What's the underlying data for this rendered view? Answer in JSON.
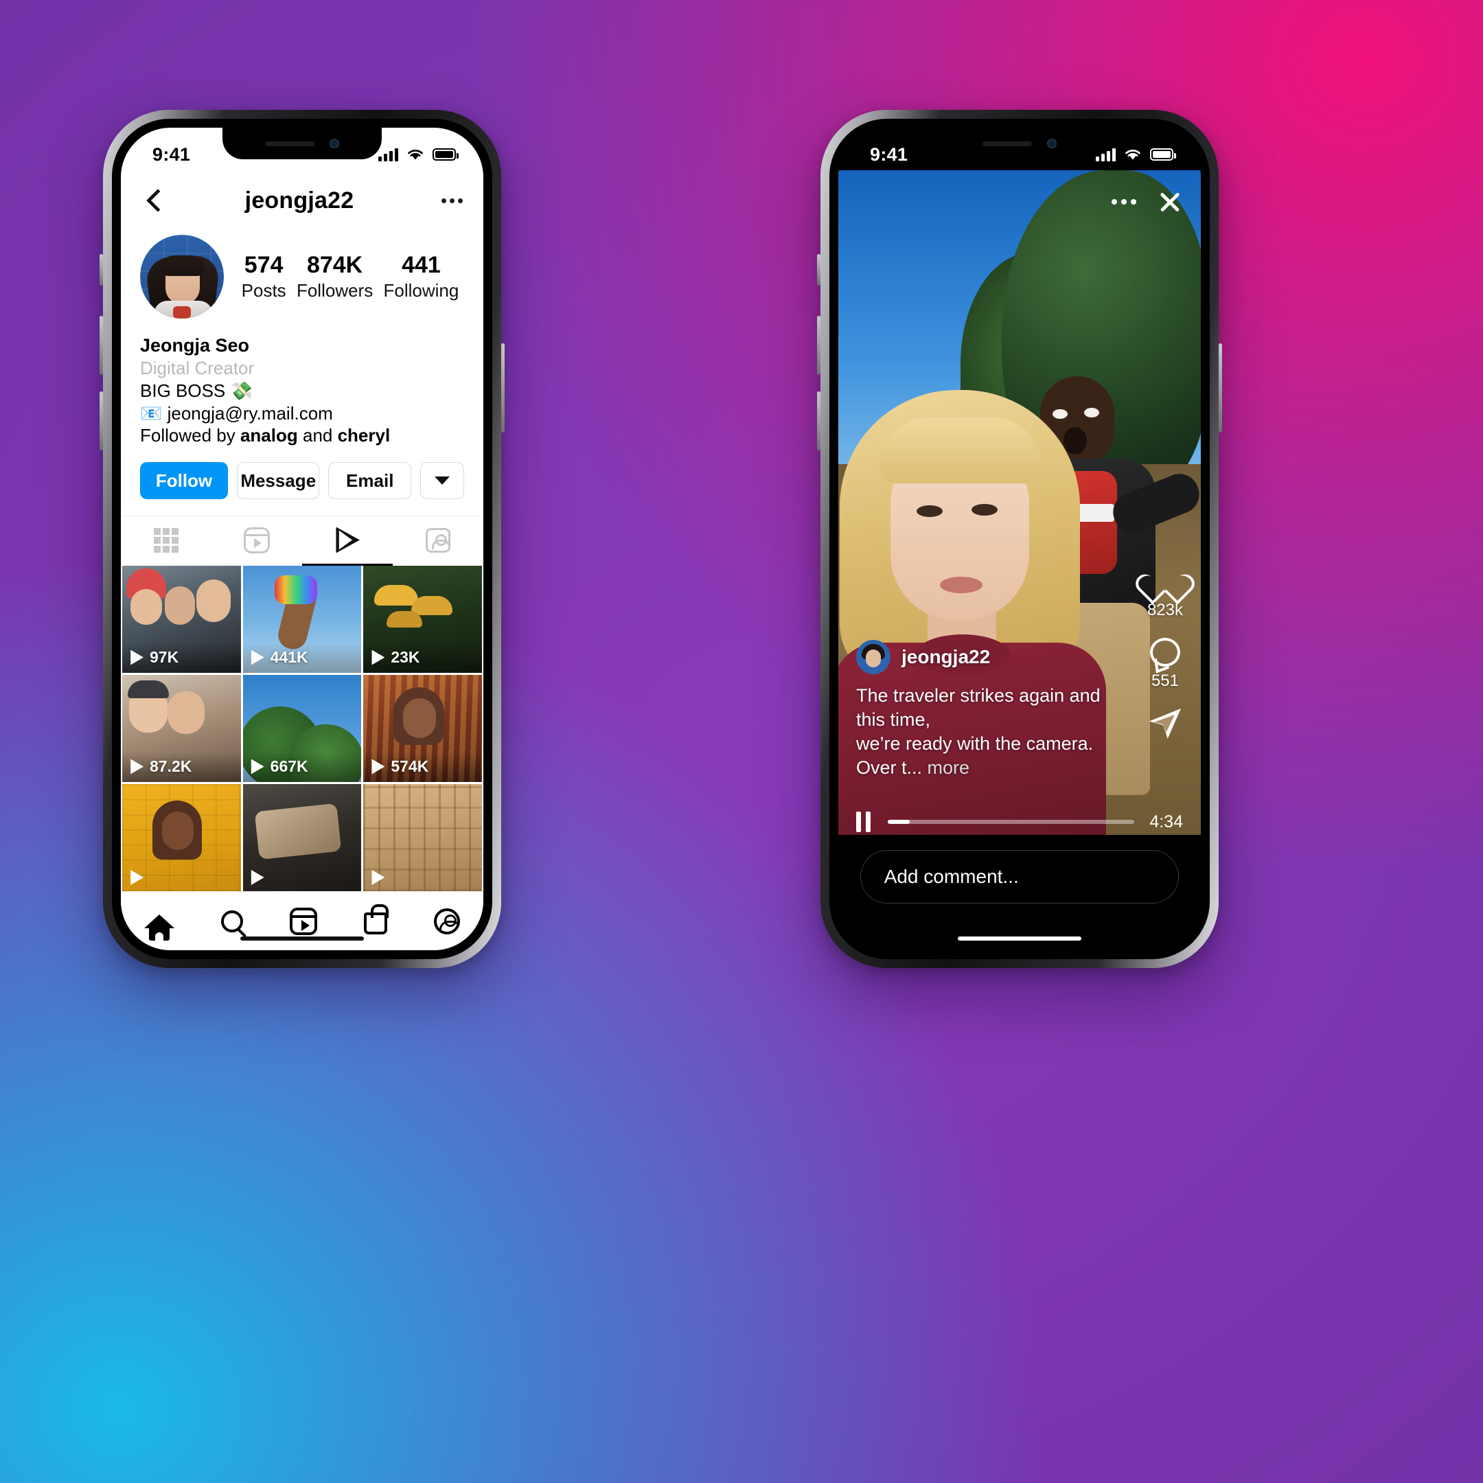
{
  "background": {
    "gradient_colors": [
      "#1ab9e8",
      "#8a3ab9",
      "#c32aa3",
      "#f0127a"
    ]
  },
  "left_phone": {
    "status_bar": {
      "time": "9:41",
      "signal_icon": "cellular-bars-icon",
      "wifi_icon": "wifi-icon",
      "battery_icon": "battery-icon"
    },
    "nav": {
      "back_icon": "back-chevron-icon",
      "title": "jeongja22",
      "more_icon": "more-options-icon"
    },
    "profile": {
      "avatar_alt": "profile-avatar",
      "stats": [
        {
          "num": "574",
          "label": "Posts"
        },
        {
          "num": "874K",
          "label": "Followers"
        },
        {
          "num": "441",
          "label": "Following"
        }
      ],
      "display_name": "Jeongja Seo",
      "category": "Digital Creator",
      "bio_line": "BIG BOSS 💸",
      "email_line": "📧 jeongja@ry.mail.com",
      "followed_by_prefix": "Followed by ",
      "followed_by_first": "analog",
      "followed_by_mid": " and ",
      "followed_by_second": "cheryl"
    },
    "actions": {
      "follow_label": "Follow",
      "message_label": "Message",
      "email_label": "Email",
      "chevron_icon": "chevron-down-icon",
      "follow_color": "#0095F6"
    },
    "tabs": [
      {
        "icon": "grid-icon",
        "active": false
      },
      {
        "icon": "reels-icon",
        "active": false
      },
      {
        "icon": "igtv-play-icon",
        "active": true
      },
      {
        "icon": "tagged-icon",
        "active": false
      }
    ],
    "grid": [
      {
        "views": "97K",
        "play_icon": "play-icon"
      },
      {
        "views": "441K",
        "play_icon": "play-icon"
      },
      {
        "views": "23K",
        "play_icon": "play-icon"
      },
      {
        "views": "87.2K",
        "play_icon": "play-icon"
      },
      {
        "views": "667K",
        "play_icon": "play-icon"
      },
      {
        "views": "574K",
        "play_icon": "play-icon"
      },
      {
        "views": "",
        "play_icon": "play-icon"
      },
      {
        "views": "",
        "play_icon": "play-icon"
      },
      {
        "views": "",
        "play_icon": "play-icon"
      }
    ],
    "tabbar": [
      {
        "icon": "home-icon"
      },
      {
        "icon": "search-icon"
      },
      {
        "icon": "reels-icon"
      },
      {
        "icon": "shop-icon"
      },
      {
        "icon": "profile-icon"
      }
    ]
  },
  "right_phone": {
    "status_bar": {
      "time": "9:41",
      "signal_icon": "cellular-bars-icon",
      "wifi_icon": "wifi-icon",
      "battery_icon": "battery-icon"
    },
    "overlay": {
      "more_icon": "more-options-icon",
      "close_icon": "close-icon",
      "username": "jeongja22",
      "avatar_alt": "reel-author-avatar",
      "caption_line1": "The traveler strikes again and this time,",
      "caption_line2": "we’re ready with the camera. Over t...",
      "more_label": "more"
    },
    "engagement": [
      {
        "icon": "heart-icon",
        "count": "823k"
      },
      {
        "icon": "comment-icon",
        "count": "551"
      },
      {
        "icon": "share-icon",
        "count": ""
      }
    ],
    "player": {
      "pause_icon": "pause-icon",
      "duration": "4:34",
      "progress_percent": 9
    },
    "comment_bar": {
      "placeholder": "Add comment..."
    }
  }
}
